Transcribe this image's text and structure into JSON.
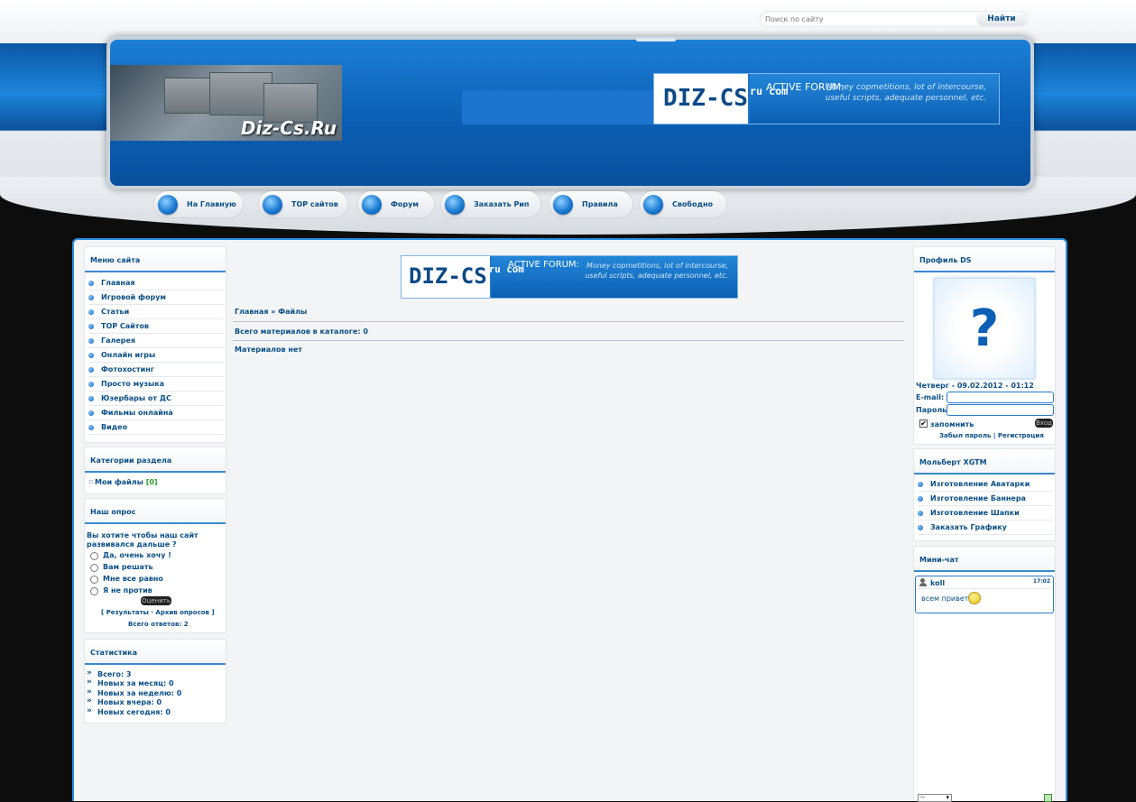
{
  "search": {
    "placeholder": "Поиск по сайту",
    "button": "Найти"
  },
  "logo": {
    "text": "Diz-Cs.Ru"
  },
  "banner": {
    "brand": "DIZ-CS",
    "domains": "ru com",
    "tagline": "ACTIVE FORUM:",
    "desc1": "Money copmetitions,  lot of intercourse,",
    "desc2": "useful scripts, adequate personnel, etc."
  },
  "nav": [
    "На Главную",
    "TOP сайтов",
    "Форум",
    "Заказать Рип",
    "Правила",
    "Свободно"
  ],
  "menu": {
    "title": "Меню сайта",
    "items": [
      "Главная",
      "Игровой форум",
      "Статьи",
      "TOP Сайтов",
      "Галерея",
      "Онлайн игры",
      "Фотохостинг",
      "Просто музыка",
      "Юзербары от ДС",
      "Фильмы онлайна",
      "Видео"
    ]
  },
  "categories": {
    "title": "Категории раздела",
    "item": "Мои файлы",
    "count": "[0]"
  },
  "poll": {
    "title": "Наш опрос",
    "question1": "Вы хотите чтобы наш сайт",
    "question2": "развивался дальше ?",
    "options": [
      "Да, очень хочу !",
      "Вам решать",
      "Мне все равно",
      "Я не против"
    ],
    "button": "Оценить",
    "links": "[  Результаты · Архив опросов  ]",
    "total": "Всего ответов:  2"
  },
  "stats": {
    "title": "Статистика",
    "lines": [
      "Всего: 3",
      "Новых за месяц: 0",
      "Новых за неделю: 0",
      "Новых вчера: 0",
      "Новых сегодня: 0"
    ]
  },
  "main": {
    "breadcrumb": "Главная » Файлы",
    "total": "Всего материалов в каталоге: 0",
    "empty": "Материалов нет"
  },
  "profile": {
    "title": "Профиль DS",
    "date": "Четверг - 09.02.2012 - 01:12",
    "email_label": "E-mail:",
    "password_label": "Пароль:",
    "remember": "запомнить",
    "login_button": "Вход",
    "forgot": "Забыл пароль",
    "register": "Регистрация",
    "separator": "|",
    "avatar_glyph": "?"
  },
  "molbert": {
    "title": "Мольберт XGTM",
    "items": [
      "Изготовление Аватарки",
      "Изготовление Баннера",
      "Изготовление Шапки",
      "Заказать Графику"
    ]
  },
  "minichat": {
    "title": "Мини-чат",
    "user": "koll",
    "time": "17:02",
    "message": "всем привет",
    "select": "--"
  },
  "colors": {
    "accent": "#0b4f86",
    "border_blue": "#2a8fe0"
  }
}
